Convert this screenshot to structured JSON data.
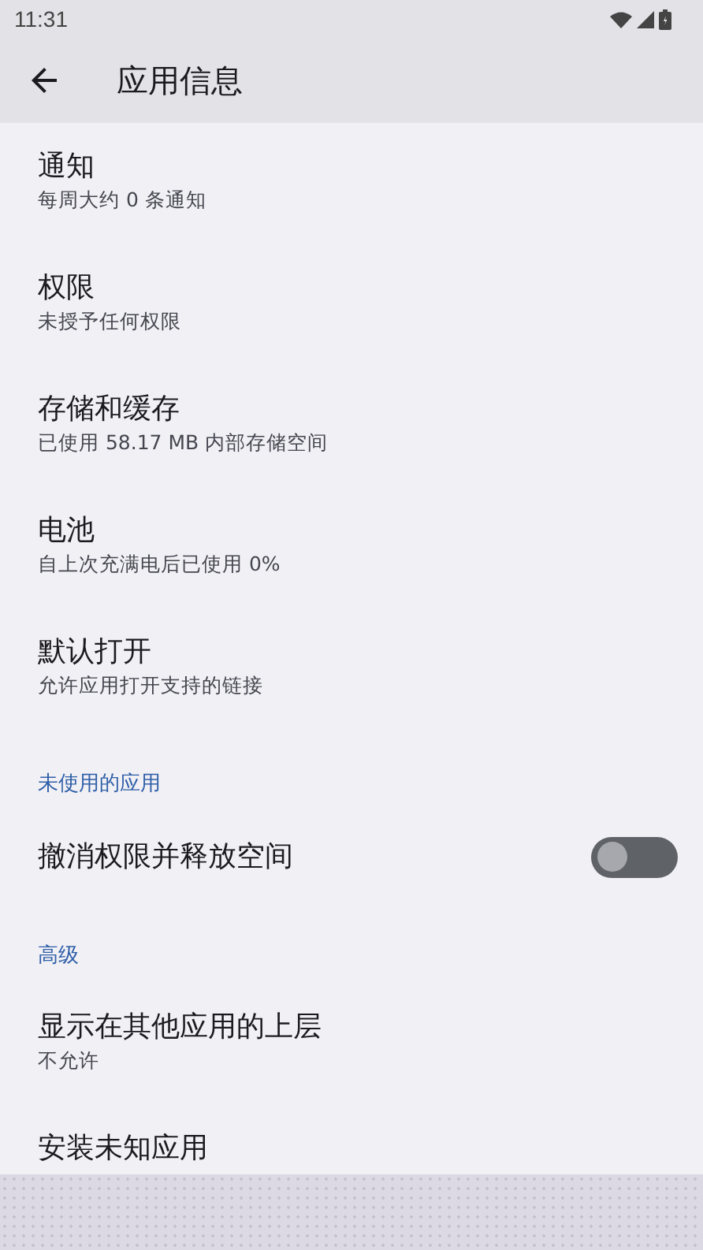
{
  "status_bar": {
    "time": "11:31"
  },
  "app_bar": {
    "title": "应用信息"
  },
  "items": [
    {
      "kind": "item",
      "title": "通知",
      "subtitle": "每周大约 0 条通知"
    },
    {
      "kind": "item",
      "title": "权限",
      "subtitle": "未授予任何权限"
    },
    {
      "kind": "item",
      "title": "存储和缓存",
      "subtitle": "已使用 58.17 MB 内部存储空间"
    },
    {
      "kind": "item",
      "title": "电池",
      "subtitle": "自上次充满电后已使用 0%"
    },
    {
      "kind": "item",
      "title": "默认打开",
      "subtitle": "允许应用打开支持的链接"
    },
    {
      "kind": "header",
      "title": "未使用的应用"
    },
    {
      "kind": "switch",
      "title": "撤消权限并释放空间",
      "on": false
    },
    {
      "kind": "header",
      "title": "高级"
    },
    {
      "kind": "item",
      "title": "显示在其他应用的上层",
      "subtitle": "不允许"
    },
    {
      "kind": "item",
      "title": "安装未知应用"
    }
  ]
}
